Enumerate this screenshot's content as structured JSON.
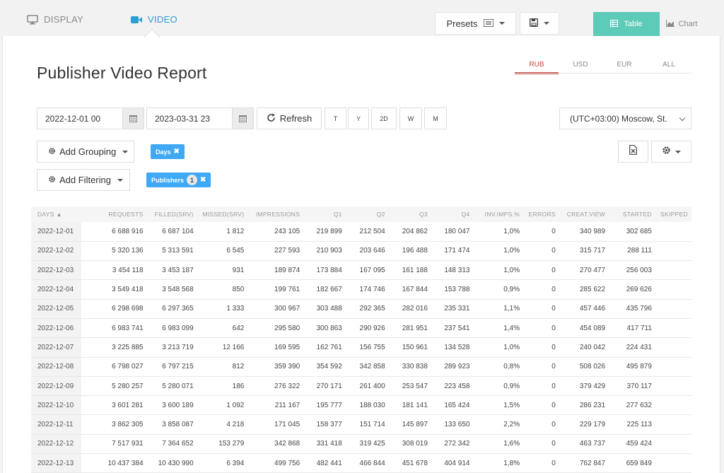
{
  "tabs": {
    "display": "DISPLAY",
    "video": "VIDEO"
  },
  "toolbar": {
    "presets": "Presets",
    "table": "Table",
    "chart": "Chart"
  },
  "page_title": "Publisher Video Report",
  "currencies": [
    "RUB",
    "USD",
    "EUR",
    "ALL"
  ],
  "active_currency": "RUB",
  "dates": {
    "from": "2022-12-01 00",
    "to": "2023-03-31 23"
  },
  "refresh_label": "Refresh",
  "periods": [
    "T",
    "Y",
    "2D",
    "W",
    "M"
  ],
  "timezone": "(UTC+03:00) Moscow, St.",
  "grouping": {
    "button": "Add Grouping",
    "chip": "Days"
  },
  "filtering": {
    "button": "Add Filtering",
    "chip": "Publishers",
    "chip_count": "1"
  },
  "colors": {
    "accent": "#2a9fd6",
    "table_btn": "#5ecbb8",
    "currency_active": "#c8443b",
    "chip": "#3fa9f5"
  },
  "table": {
    "columns": [
      "DAYS ▲",
      "REQUESTS",
      "FILLED(SRV)",
      "MISSED(SRV)",
      "IMPRESSIONS",
      "Q1",
      "Q2",
      "Q3",
      "Q4",
      "INV.IMPS.%",
      "ERRORS",
      "CREAT.VIEW",
      "STARTED",
      "SKIPPED"
    ],
    "rows": [
      [
        "2022-12-01",
        "6 688 916",
        "6 687 104",
        "1 812",
        "243 105",
        "219 899",
        "212 504",
        "204 862",
        "180 047",
        "1,0%",
        "0",
        "340 989",
        "302 685",
        ""
      ],
      [
        "2022-12-02",
        "5 320 136",
        "5 313 591",
        "6 545",
        "227 593",
        "210 903",
        "203 646",
        "196 488",
        "171 474",
        "1,0%",
        "0",
        "315 717",
        "288 111",
        ""
      ],
      [
        "2022-12-03",
        "3 454 118",
        "3 453 187",
        "931",
        "189 874",
        "173 884",
        "167 095",
        "161 188",
        "148 313",
        "1,0%",
        "0",
        "270 477",
        "256 003",
        ""
      ],
      [
        "2022-12-04",
        "3 549 418",
        "3 548 568",
        "850",
        "199 761",
        "182 667",
        "174 746",
        "167 844",
        "153 788",
        "0,9%",
        "0",
        "285 622",
        "269 626",
        ""
      ],
      [
        "2022-12-05",
        "6 298 698",
        "6 297 365",
        "1 333",
        "300 967",
        "303 488",
        "292 365",
        "282 016",
        "235 331",
        "1,1%",
        "0",
        "457 446",
        "435 796",
        ""
      ],
      [
        "2022-12-06",
        "6 983 741",
        "6 983 099",
        "642",
        "295 580",
        "300 863",
        "290 926",
        "281 951",
        "237 541",
        "1,4%",
        "0",
        "454 089",
        "417 711",
        ""
      ],
      [
        "2022-12-07",
        "3 225 885",
        "3 213 719",
        "12 166",
        "169 595",
        "162 761",
        "156 755",
        "150 961",
        "134 528",
        "1,0%",
        "0",
        "240 042",
        "224 431",
        ""
      ],
      [
        "2022-12-08",
        "6 798 027",
        "6 797 215",
        "812",
        "359 390",
        "354 592",
        "342 858",
        "330 838",
        "289 923",
        "0,8%",
        "0",
        "508 026",
        "495 879",
        ""
      ],
      [
        "2022-12-09",
        "5 280 257",
        "5 280 071",
        "186",
        "276 322",
        "270 171",
        "261 400",
        "253 547",
        "223 458",
        "0,9%",
        "0",
        "379 429",
        "370 117",
        ""
      ],
      [
        "2022-12-10",
        "3 601 281",
        "3 600 189",
        "1 092",
        "211 167",
        "195 777",
        "188 030",
        "181 141",
        "165 424",
        "1,5%",
        "0",
        "286 231",
        "277 632",
        ""
      ],
      [
        "2022-12-11",
        "3 862 305",
        "3 858 087",
        "4 218",
        "171 045",
        "158 377",
        "151 714",
        "145 897",
        "133 650",
        "2,2%",
        "0",
        "229 179",
        "225 113",
        ""
      ],
      [
        "2022-12-12",
        "7 517 931",
        "7 364 652",
        "153 279",
        "342 868",
        "331 418",
        "319 425",
        "308 019",
        "272 342",
        "1,6%",
        "0",
        "463 737",
        "459 424",
        ""
      ],
      [
        "2022-12-13",
        "10 437 384",
        "10 430 990",
        "6 394",
        "499 756",
        "482 441",
        "466 844",
        "451 678",
        "404 914",
        "1,8%",
        "0",
        "762 847",
        "659 849",
        ""
      ]
    ]
  }
}
